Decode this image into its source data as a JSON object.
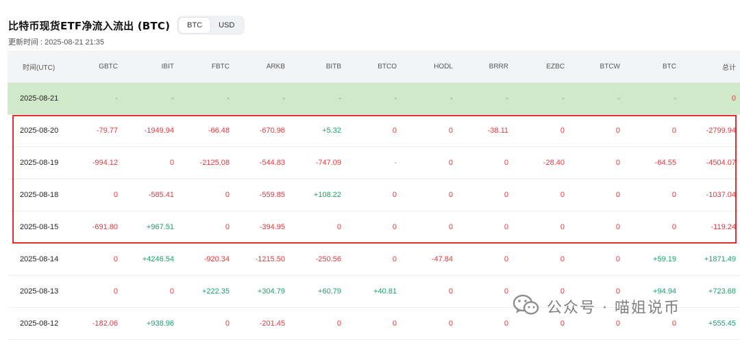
{
  "page": {
    "title": "比特币现货ETF净流入流出 (BTC)",
    "unit_toggle": {
      "options": [
        "BTC",
        "USD"
      ],
      "selected": "BTC"
    },
    "updated": "更新时间 : 2025-08-21 21:35"
  },
  "table": {
    "columns": [
      "时间(UTC)",
      "GBTC",
      "IBIT",
      "FBTC",
      "ARKB",
      "BITB",
      "BTCO",
      "HODL",
      "BRRR",
      "EZBC",
      "BTCW",
      "BTC",
      "总计"
    ],
    "rows": [
      [
        "2025-08-21",
        "-",
        "-",
        "-",
        "-",
        "-",
        "-",
        "-",
        "-",
        "-",
        "-",
        "-",
        "0"
      ],
      [
        "2025-08-20",
        "-79.77",
        "-1949.94",
        "-66.48",
        "-670.96",
        "+5.32",
        "0",
        "0",
        "-38.11",
        "0",
        "0",
        "0",
        "-2799.94"
      ],
      [
        "2025-08-19",
        "-994.12",
        "0",
        "-2125.08",
        "-544.83",
        "-747.09",
        "-",
        "0",
        "0",
        "-28.40",
        "0",
        "-64.55",
        "-4504.07"
      ],
      [
        "2025-08-18",
        "0",
        "-585.41",
        "0",
        "-559.85",
        "+108.22",
        "0",
        "0",
        "0",
        "0",
        "0",
        "0",
        "-1037.04"
      ],
      [
        "2025-08-15",
        "-691.80",
        "+967.51",
        "0",
        "-394.95",
        "0",
        "0",
        "0",
        "0",
        "0",
        "0",
        "0",
        "-119.24"
      ],
      [
        "2025-08-14",
        "0",
        "+4246.54",
        "-920.34",
        "-1215.50",
        "-250.56",
        "0",
        "-47.84",
        "0",
        "0",
        "0",
        "+59.19",
        "+1871.49"
      ],
      [
        "2025-08-13",
        "0",
        "0",
        "+222.35",
        "+304.79",
        "+60.79",
        "+40.81",
        "0",
        "0",
        "0",
        "0",
        "+94.94",
        "+723.68"
      ],
      [
        "2025-08-12",
        "-182.06",
        "+938.96",
        "0",
        "-201.45",
        "0",
        "0",
        "0",
        "0",
        "0",
        "0",
        "0",
        "+555.45"
      ]
    ],
    "highlighted_row": "2025-08-21",
    "colors": {
      "negative": "#e5363c",
      "positive": "#17a36a",
      "highlight_bg": "#cfe9c9",
      "annotation_box": "#e22d2d"
    }
  },
  "watermark": {
    "icon": "wechat-icon",
    "text": "公众号 · 喵姐说币"
  }
}
